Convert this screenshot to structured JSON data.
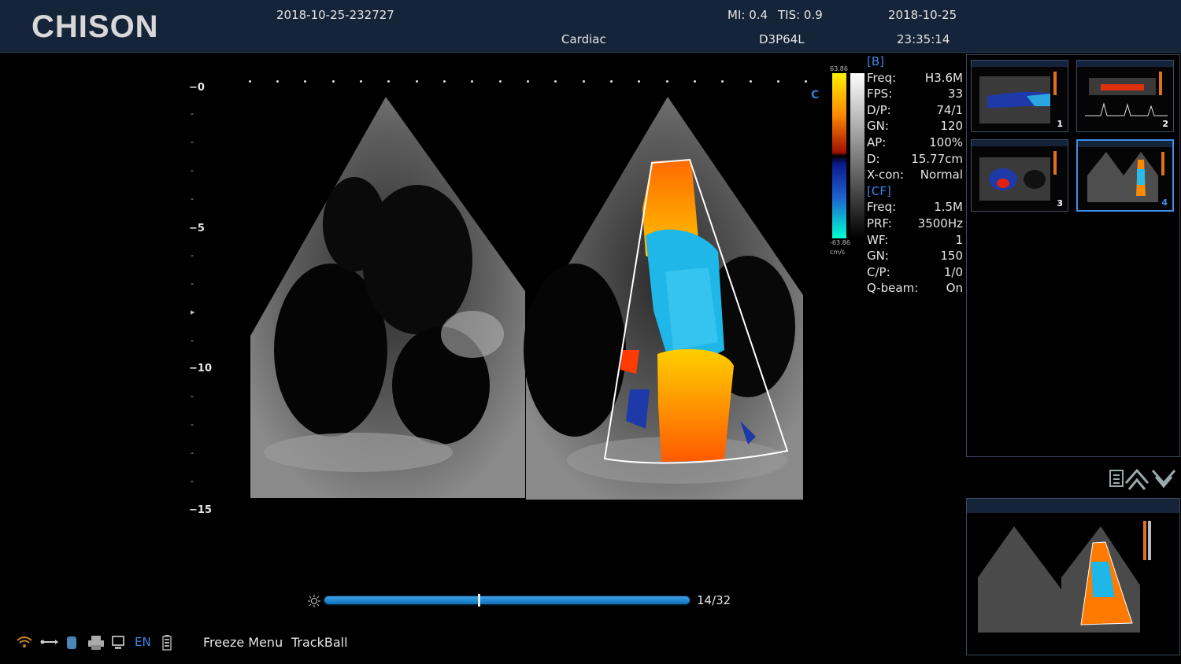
{
  "header": {
    "brand": "CHISON",
    "patient_id": "2018-10-25-232727",
    "mi": "MI: 0.4",
    "tis": "TIS: 0.9",
    "date": "2018-10-25",
    "exam": "Cardiac",
    "probe": "D3P64L",
    "time": "23:35:14"
  },
  "ruler": {
    "major": [
      "0",
      "5",
      "10",
      "15"
    ]
  },
  "image": {
    "mode_letter": "C"
  },
  "color_scale": {
    "max": "63.86",
    "min": "-63.86",
    "unit": "cm/s"
  },
  "params": {
    "b_header": "[B]",
    "b": [
      {
        "k": "Freq:",
        "v": "H3.6M"
      },
      {
        "k": "FPS:",
        "v": "33"
      },
      {
        "k": "D/P:",
        "v": "74/1"
      },
      {
        "k": "GN:",
        "v": "120"
      },
      {
        "k": "AP:",
        "v": "100%"
      },
      {
        "k": "D:",
        "v": "15.77cm"
      },
      {
        "k": "X-con:",
        "v": "Normal"
      }
    ],
    "cf_header": "[CF]",
    "cf": [
      {
        "k": "Freq:",
        "v": "1.5M"
      },
      {
        "k": "PRF:",
        "v": "3500Hz"
      },
      {
        "k": "WF:",
        "v": "1"
      },
      {
        "k": "GN:",
        "v": "150"
      },
      {
        "k": "C/P:",
        "v": "1/0"
      },
      {
        "k": "Q-beam:",
        "v": "On"
      }
    ]
  },
  "thumbnails": [
    "1",
    "2",
    "3",
    "4"
  ],
  "cine": {
    "frame_label": "14/32",
    "progress": 0.42
  },
  "status": {
    "language": "EN",
    "freeze_menu": "Freeze Menu",
    "trackball": "TrackBall"
  },
  "colors": {
    "header_bg": "#16243a",
    "accent": "#3a86e6",
    "cine": "#1a7fd0"
  },
  "icons": [
    "wifi-icon",
    "usb-icon",
    "storage-icon",
    "printer-icon",
    "monitor-icon",
    "battery-icon",
    "brightness-icon",
    "menu-icon",
    "chevron-up-icon",
    "chevron-down-icon"
  ]
}
